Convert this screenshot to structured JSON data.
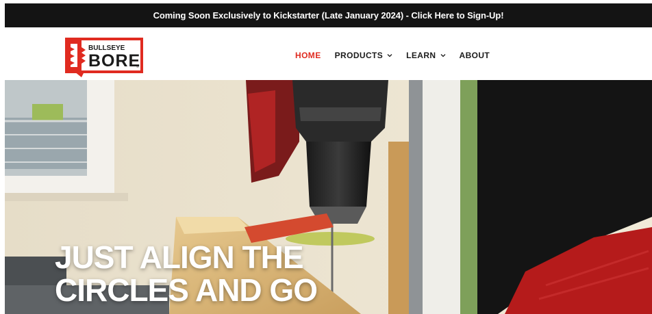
{
  "announcement": {
    "text": "Coming Soon Exclusively to Kickstarter (Late January 2024) -  Click Here to Sign-Up!"
  },
  "logo": {
    "line1": "BULLSEYE",
    "line2": "BORE",
    "trademark": "®"
  },
  "nav": {
    "items": [
      {
        "label": "HOME",
        "active": true
      },
      {
        "label": "PRODUCTS",
        "dropdown": true
      },
      {
        "label": "LEARN",
        "dropdown": true
      },
      {
        "label": "ABOUT"
      }
    ]
  },
  "hero": {
    "headline_line1": "JUST ALIGN THE",
    "headline_line2": "CIRCLES AND GO"
  },
  "colors": {
    "accent": "#e02b20",
    "announcement_bg": "#141414",
    "nav_text": "#1b1b1b"
  }
}
